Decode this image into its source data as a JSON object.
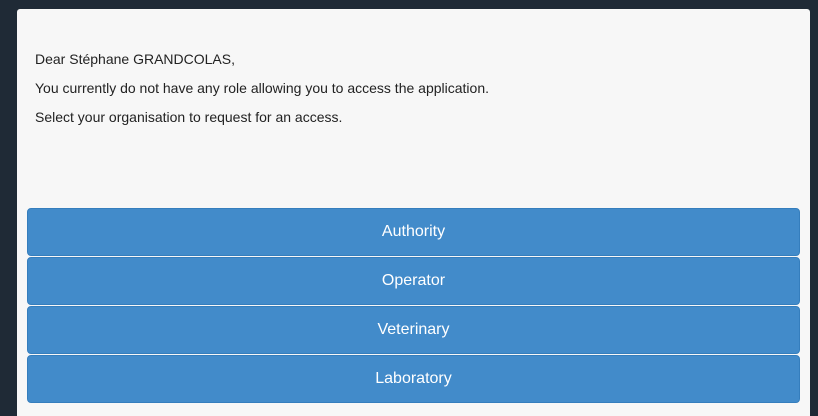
{
  "message": {
    "greeting": "Dear Stéphane GRANDCOLAS,",
    "no_role": "You currently do not have any role allowing you to access the application.",
    "instruction": "Select your organisation to request for an access."
  },
  "options": [
    {
      "label": "Authority"
    },
    {
      "label": "Operator"
    },
    {
      "label": "Veterinary"
    },
    {
      "label": "Laboratory"
    }
  ],
  "colors": {
    "button_background": "#428bca",
    "page_background": "#1f2a36",
    "panel_background": "#f7f7f7"
  }
}
